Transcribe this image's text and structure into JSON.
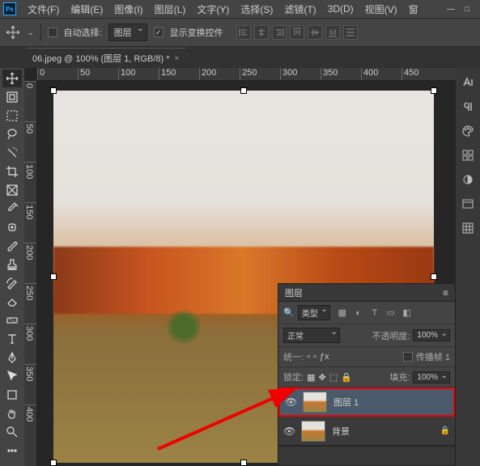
{
  "menubar": {
    "items": [
      "文件(F)",
      "编辑(E)",
      "图像(I)",
      "图层(L)",
      "文字(Y)",
      "选择(S)",
      "滤镜(T)",
      "3D(D)",
      "视图(V)",
      "窗"
    ]
  },
  "options": {
    "auto_select_label": "自动选择:",
    "auto_select_target": "图层",
    "show_transform_label": "显示变换控件"
  },
  "doc": {
    "tab_title": "06.jpeg @ 100% (图层 1, RGB/8) *"
  },
  "ruler_h": [
    "0",
    "50",
    "100",
    "150",
    "200",
    "250",
    "300",
    "350",
    "400",
    "450"
  ],
  "ruler_v": [
    "0",
    "50",
    "100",
    "150",
    "200",
    "250",
    "300",
    "350",
    "400"
  ],
  "layers": {
    "panel_title": "图层",
    "filter_label": "类型",
    "blend_mode": "正常",
    "opacity_label": "不透明度:",
    "opacity_value": "100%",
    "unify_label": "统一:",
    "propagate_label": "传播帧 1",
    "lock_label": "锁定:",
    "fill_label": "填充:",
    "fill_value": "100%",
    "items": [
      {
        "name": "图层 1",
        "locked": false
      },
      {
        "name": "背景",
        "locked": true
      }
    ]
  }
}
